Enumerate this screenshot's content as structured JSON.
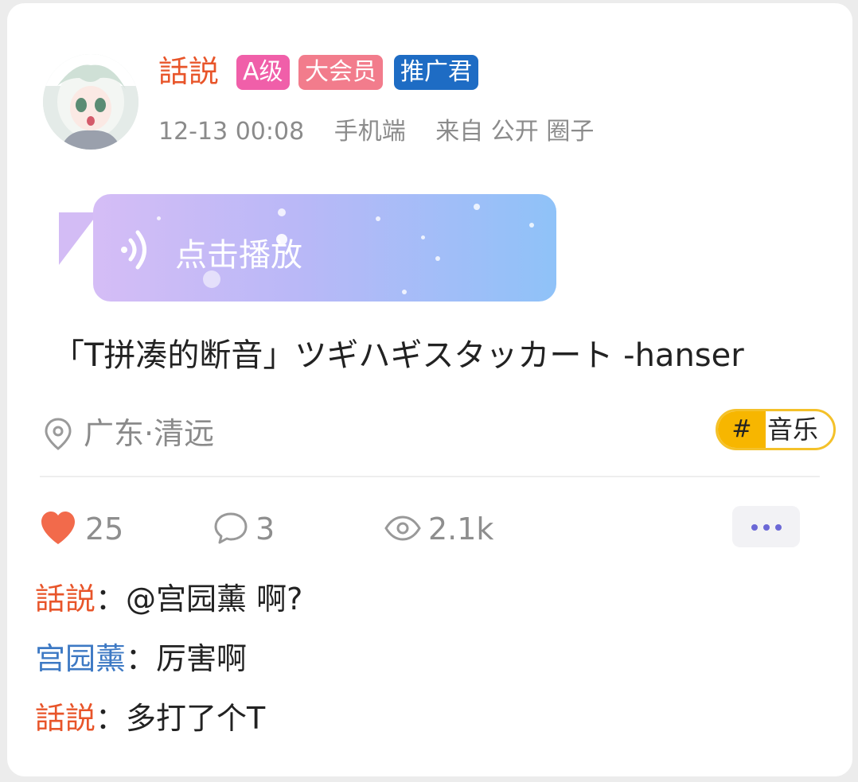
{
  "post": {
    "author": "話説",
    "badges": {
      "level": "A级",
      "vip": "大会员",
      "promo": "推广君"
    },
    "time": "12-13 00:08",
    "device": "手机端",
    "source": "来自 公开 圈子",
    "voice_label": "点击播放",
    "title": "「T拼凑的断音」ツギハギスタッカート -hanser",
    "location": "广东·清远",
    "tag_hash": "#",
    "tag": "音乐"
  },
  "stats": {
    "likes": "25",
    "comments": "3",
    "views": "2.1k"
  },
  "comments": [
    {
      "author": "話説",
      "sep": "：",
      "text": "@宫园薰 啊?"
    },
    {
      "author": "宫园薰",
      "sep": "：",
      "text": "厉害啊"
    },
    {
      "author": "話説",
      "sep": "：",
      "text": "多打了个T"
    }
  ],
  "colors": {
    "author": "#e8552a",
    "reply_author": "#3d79c4",
    "badge_a": "#f05fa9",
    "badge_vip": "#f27c8c",
    "badge_promo": "#1e6cc4",
    "tag_accent": "#f7b600",
    "like_heart": "#f26a4b",
    "more_dots": "#6b68d6"
  },
  "icons": {
    "like": "heart-icon",
    "comment": "speech-bubble-icon",
    "views": "eye-icon",
    "location": "location-pin-icon",
    "voice": "sound-wave-icon",
    "more": "more-dots-icon"
  }
}
